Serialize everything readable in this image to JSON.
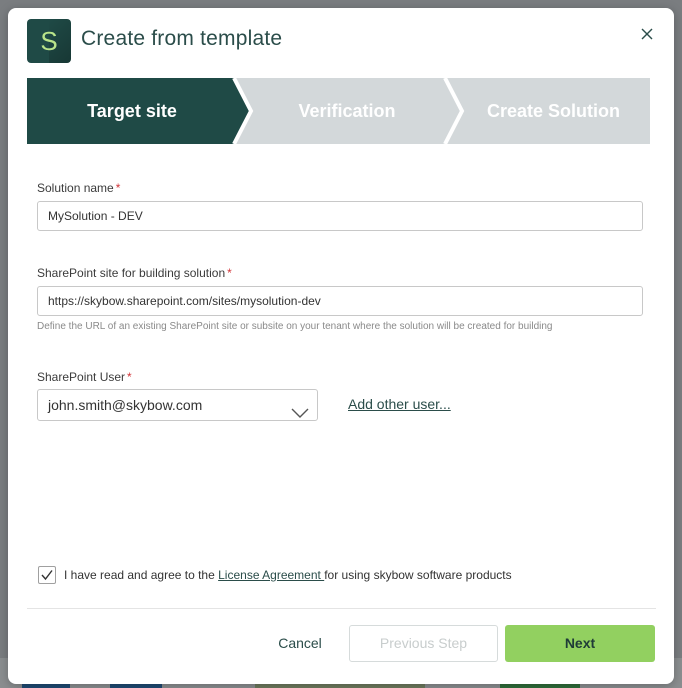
{
  "dialog": {
    "logo_letter": "S",
    "title": "Create from template"
  },
  "steps": [
    {
      "label": "Target site",
      "state": "active"
    },
    {
      "label": "Verification",
      "state": "inactive"
    },
    {
      "label": "Create Solution",
      "state": "inactive"
    }
  ],
  "colors": {
    "step_active": "#1f4a46",
    "step_inactive": "#d3d8da",
    "accent": "#2b4d4a",
    "next_button": "#92d060",
    "required": "#d13438"
  },
  "form": {
    "solution_name": {
      "label": "Solution name",
      "required_mark": "*",
      "value": "MySolution - DEV"
    },
    "sharepoint_site": {
      "label": "SharePoint site for building solution",
      "required_mark": "*",
      "value": "https://skybow.sharepoint.com/sites/mysolution-dev",
      "hint": "Define the URL of an existing SharePoint site or subsite on your tenant where the solution will be created for building"
    },
    "sharepoint_user": {
      "label": "SharePoint User",
      "required_mark": "*",
      "selected": "john.smith@skybow.com",
      "add_link": "Add other user..."
    }
  },
  "agreement": {
    "checked": true,
    "prefix": "I have read and agree to the ",
    "link": "License Agreement ",
    "suffix": "for using skybow software products"
  },
  "footer": {
    "cancel": "Cancel",
    "previous": "Previous Step",
    "next": "Next"
  },
  "icons": {
    "close": "close-icon",
    "dropdown": "chevron-down-icon",
    "check": "checkmark-icon"
  }
}
